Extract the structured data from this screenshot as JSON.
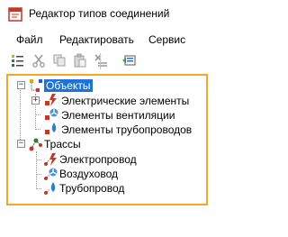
{
  "window": {
    "title": "Редактор типов соединений"
  },
  "menu": [
    "Файл",
    "Редактировать",
    "Сервис"
  ],
  "toolbar": {
    "buttons": [
      "new-item-icon",
      "cut-icon",
      "copy-icon",
      "paste-icon",
      "delete-icon",
      "apply-icon"
    ]
  },
  "tree": {
    "root_objects": "Объекты",
    "objects_children": [
      "Электрические элементы",
      "Элементы вентиляции",
      "Элементы трубопроводов"
    ],
    "root_routes": "Трассы",
    "routes_children": [
      "Электропровод",
      "Воздуховод",
      "Трубопровод"
    ]
  },
  "colors": {
    "selection": "#1e73d4",
    "highlight_border": "#f5a623"
  }
}
